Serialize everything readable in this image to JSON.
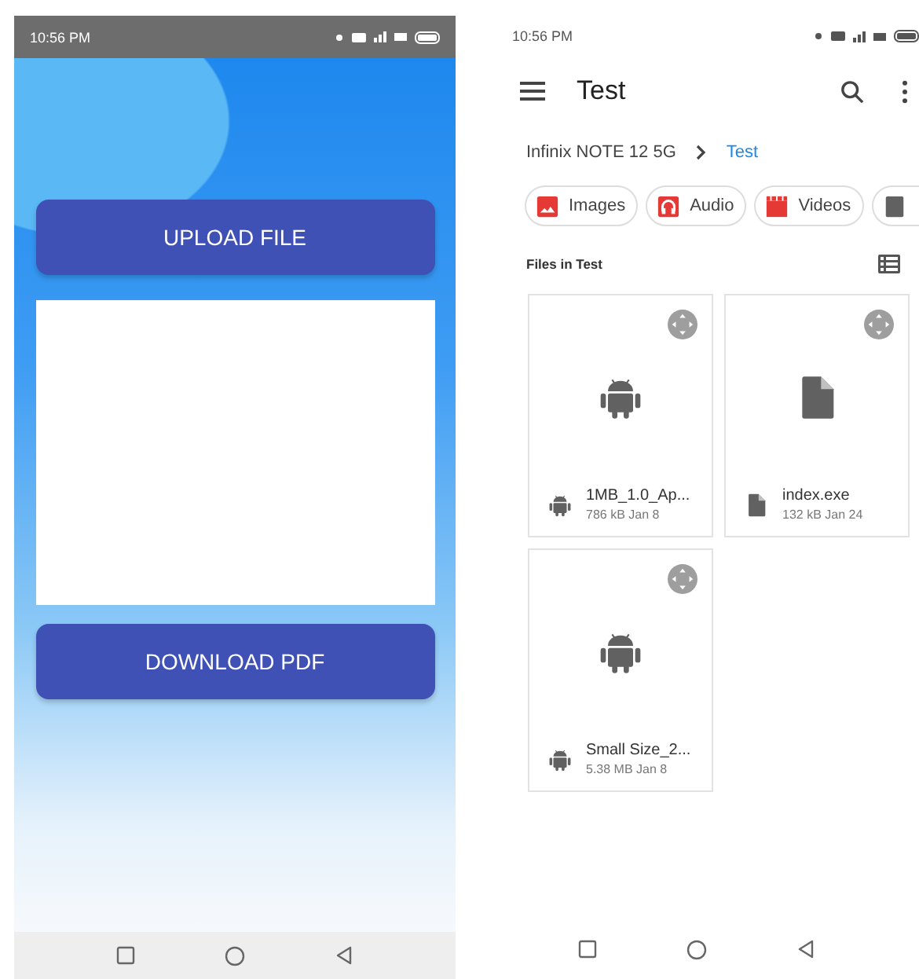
{
  "left_phone": {
    "status_bar": {
      "time": "10:56 PM"
    },
    "upload_button": {
      "label": "UPLOAD FILE"
    },
    "download_button": {
      "label": "DOWNLOAD PDF"
    }
  },
  "right_phone": {
    "status_bar": {
      "time": "10:56 PM"
    },
    "app_bar": {
      "title": "Test"
    },
    "breadcrumb": [
      {
        "label": "Infinix NOTE 12 5G",
        "selected": false
      },
      {
        "label": "Test",
        "selected": true
      }
    ],
    "chips": [
      {
        "kind": "images",
        "label": "Images"
      },
      {
        "kind": "audio",
        "label": "Audio"
      },
      {
        "kind": "videos",
        "label": "Videos"
      },
      {
        "kind": "documents"
      }
    ],
    "section_title": "Files in Test",
    "files": [
      {
        "kind": "android",
        "name": "1MB_1.0_Ap...",
        "meta": "786 kB Jan 8"
      },
      {
        "kind": "document",
        "name": "index.exe",
        "meta": "132 kB Jan 24"
      },
      {
        "kind": "android",
        "name": "Small Size_2...",
        "meta": "5.38 MB Jan 8"
      }
    ]
  }
}
